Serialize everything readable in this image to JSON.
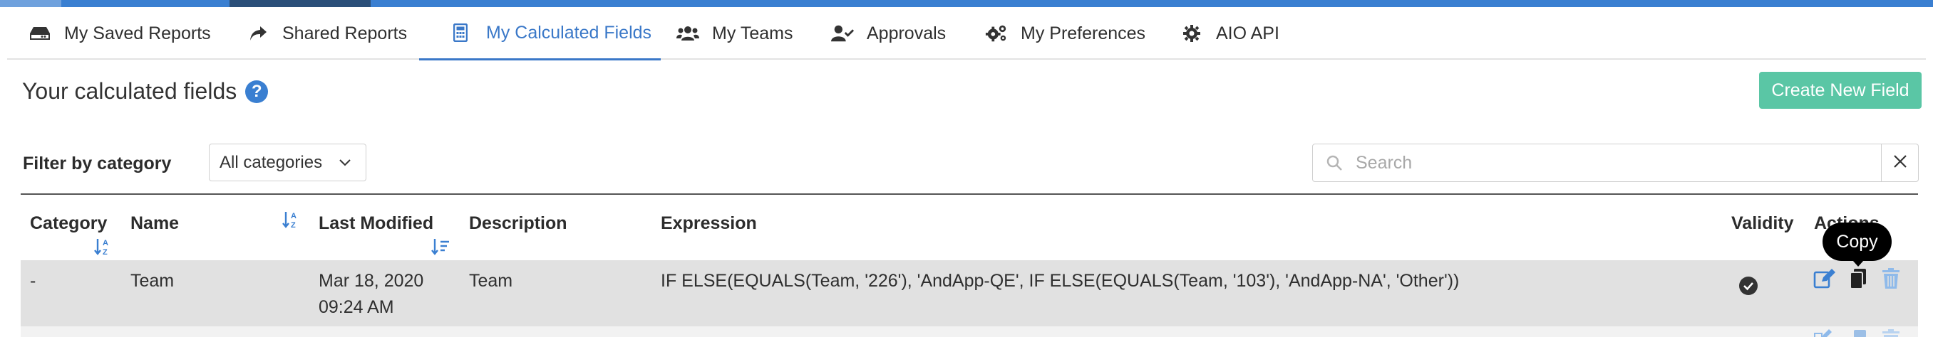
{
  "tabs": [
    {
      "label": "My Saved Reports",
      "icon": "drive-icon"
    },
    {
      "label": "Shared Reports",
      "icon": "share-arrow-icon"
    },
    {
      "label": "My Calculated Fields",
      "icon": "calculator-icon",
      "active": true
    },
    {
      "label": "My Teams",
      "icon": "users-icon"
    },
    {
      "label": "Approvals",
      "icon": "user-check-icon"
    },
    {
      "label": "My Preferences",
      "icon": "gears-icon"
    },
    {
      "label": "AIO API",
      "icon": "gear-icon"
    }
  ],
  "page": {
    "title": "Your calculated fields",
    "help_glyph": "?",
    "create_button": "Create New Field"
  },
  "filter": {
    "label": "Filter by category",
    "selected": "All categories"
  },
  "search": {
    "placeholder": "Search",
    "value": ""
  },
  "table": {
    "headers": {
      "category": "Category",
      "name": "Name",
      "last_modified": "Last Modified",
      "description": "Description",
      "expression": "Expression",
      "validity": "Validity",
      "actions": "Actions"
    },
    "rows": [
      {
        "category": "-",
        "name": "Team",
        "last_modified_date": "Mar 18, 2020",
        "last_modified_time": "09:24 AM",
        "description": "Team",
        "expression": "IF ELSE(EQUALS(Team, '226'), 'AndApp-QE', IF ELSE(EQUALS(Team, '103'), 'AndApp-NA', 'Other'))",
        "valid": true
      }
    ]
  },
  "tooltip": {
    "text": "Copy"
  },
  "colors": {
    "accent": "#3a7fd1",
    "create_button": "#5ac6a5",
    "action_icon": "#3a7fd1",
    "row_bg": "#e1e1e1"
  }
}
